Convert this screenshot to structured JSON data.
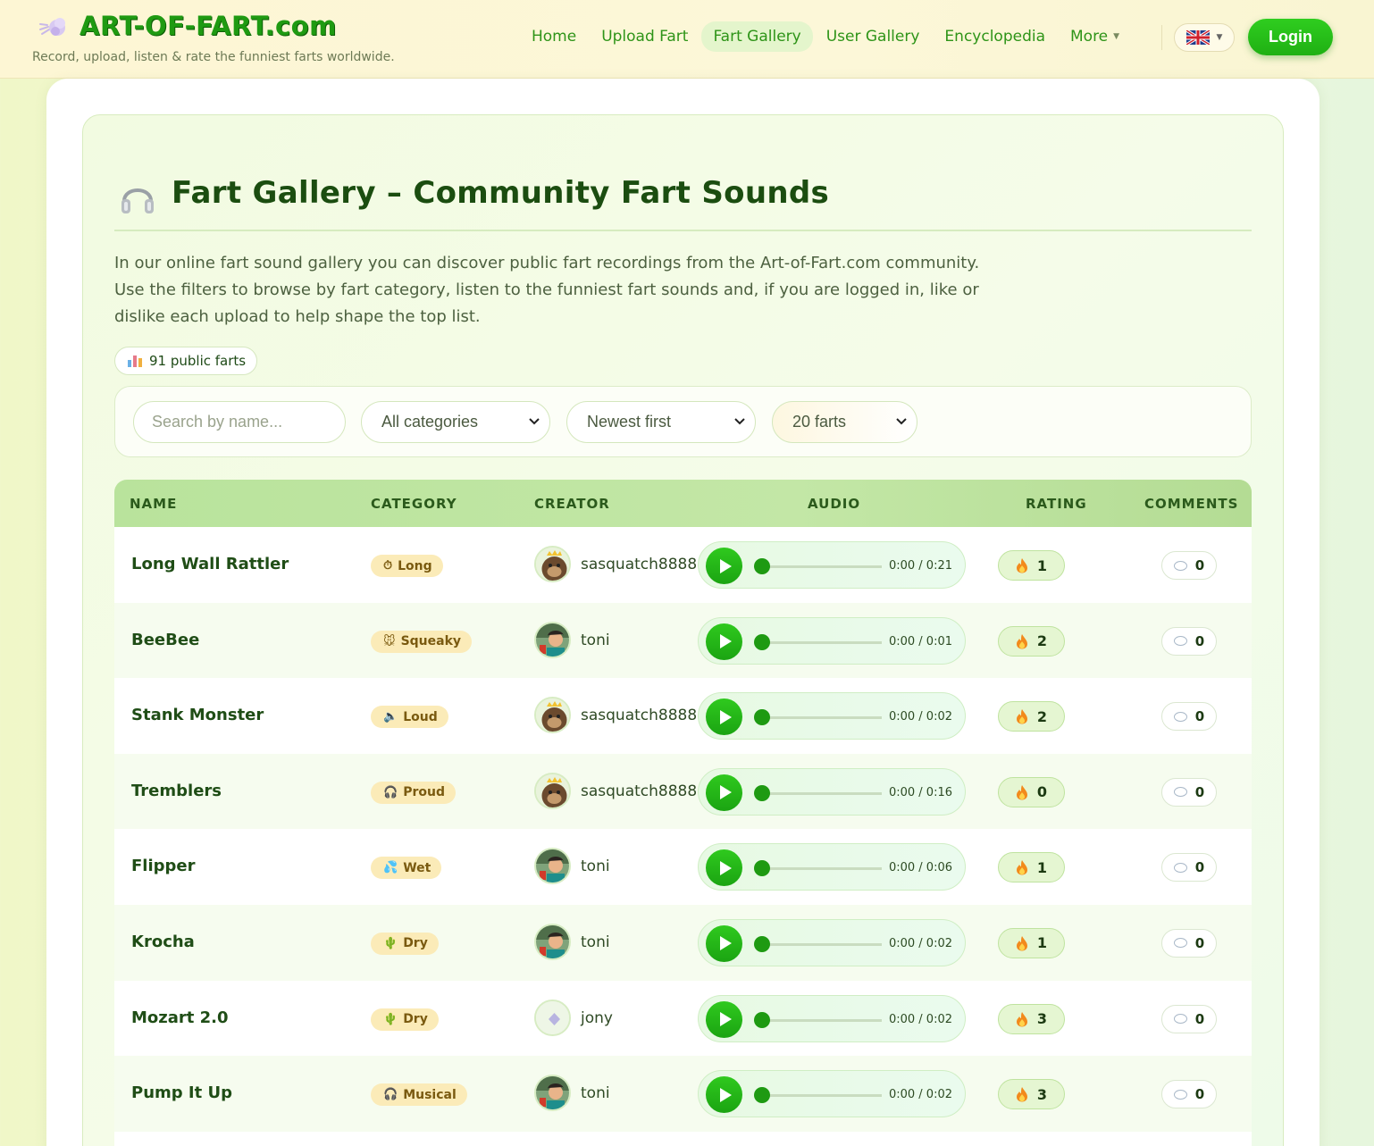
{
  "brand": {
    "title": "ART-OF-FART.com",
    "tagline": "Record, upload, listen & rate the funniest farts worldwide."
  },
  "nav": {
    "items": [
      {
        "label": "Home",
        "active": false
      },
      {
        "label": "Upload Fart",
        "active": false
      },
      {
        "label": "Fart Gallery",
        "active": true
      },
      {
        "label": "User Gallery",
        "active": false
      },
      {
        "label": "Encyclopedia",
        "active": false
      }
    ],
    "more_label": "More",
    "language": "en-GB",
    "login_label": "Login"
  },
  "page": {
    "title": "Fart Gallery – Community Fart Sounds",
    "intro": "In our online fart sound gallery you can discover public fart recordings from the Art-of-Fart.com community. Use the filters to browse by fart category, listen to the funniest fart sounds and, if you are logged in, like or dislike each upload to help shape the top list.",
    "count_label": "91 public farts"
  },
  "filters": {
    "search_placeholder": "Search by name...",
    "category_value": "All categories",
    "sort_value": "Newest first",
    "per_page_value": "20 farts"
  },
  "table": {
    "headers": {
      "name": "NAME",
      "category": "CATEGORY",
      "creator": "CREATOR",
      "audio": "AUDIO",
      "rating": "RATING",
      "comments": "COMMENTS"
    },
    "rows": [
      {
        "name": "Long Wall Rattler",
        "category": "Long",
        "category_icon": "stopwatch-icon",
        "creator": "sasquatch8888",
        "avatar": "gorilla",
        "time": "0:00 / 0:21",
        "rating": "1",
        "comments": "0"
      },
      {
        "name": "BeeBee",
        "category": "Squeaky",
        "category_icon": "mouse-icon",
        "creator": "toni",
        "avatar": "toni",
        "time": "0:00 / 0:01",
        "rating": "2",
        "comments": "0"
      },
      {
        "name": "Stank Monster",
        "category": "Loud",
        "category_icon": "speaker-icon",
        "creator": "sasquatch8888",
        "avatar": "gorilla",
        "time": "0:00 / 0:02",
        "rating": "2",
        "comments": "0"
      },
      {
        "name": "Tremblers",
        "category": "Proud",
        "category_icon": "headphones-icon",
        "creator": "sasquatch8888",
        "avatar": "gorilla",
        "time": "0:00 / 0:16",
        "rating": "0",
        "comments": "0"
      },
      {
        "name": "Flipper",
        "category": "Wet",
        "category_icon": "droplets-icon",
        "creator": "toni",
        "avatar": "toni",
        "time": "0:00 / 0:06",
        "rating": "1",
        "comments": "0"
      },
      {
        "name": "Krocha",
        "category": "Dry",
        "category_icon": "cactus-icon",
        "creator": "toni",
        "avatar": "toni",
        "time": "0:00 / 0:02",
        "rating": "1",
        "comments": "0"
      },
      {
        "name": "Mozart 2.0",
        "category": "Dry",
        "category_icon": "cactus-icon",
        "creator": "jony",
        "avatar": "default",
        "time": "0:00 / 0:02",
        "rating": "3",
        "comments": "0"
      },
      {
        "name": "Pump It Up",
        "category": "Musical",
        "category_icon": "headphones-icon",
        "creator": "toni",
        "avatar": "toni",
        "time": "0:00 / 0:02",
        "rating": "3",
        "comments": "0"
      }
    ]
  },
  "colors": {
    "brand_green": "#1f9a12",
    "play_green": "#2fc91e",
    "badge_yellow": "#fbebb8",
    "header_green": "#b9e39c"
  }
}
